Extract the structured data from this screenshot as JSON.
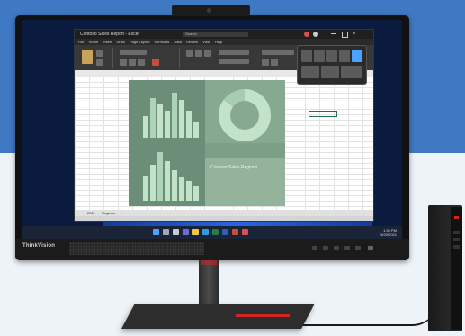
{
  "brand": {
    "logo_text": "ThinkVision"
  },
  "excel": {
    "window_title": "Contoso Sales Report - Excel",
    "search_placeholder": "Search",
    "menu": [
      "File",
      "Home",
      "Insert",
      "Draw",
      "Page Layout",
      "Formulas",
      "Data",
      "Review",
      "View",
      "Help"
    ],
    "sheet_tabs": [
      "2021",
      "Regions",
      "+"
    ],
    "dashboard_title": "Contoso Sales Regions"
  },
  "taskbar": {
    "time": "1:30 PM",
    "date": "5/20/2021"
  },
  "colors": {
    "accent": "#d52222",
    "dashboard_green": "#6c8e78",
    "bar_green": "#c3e2ca",
    "wallpaper_blue": "#2f73ff"
  },
  "icons": [
    "webcam-icon",
    "windows-start-icon",
    "search-icon",
    "excel-icon",
    "edge-icon",
    "teams-icon"
  ]
}
